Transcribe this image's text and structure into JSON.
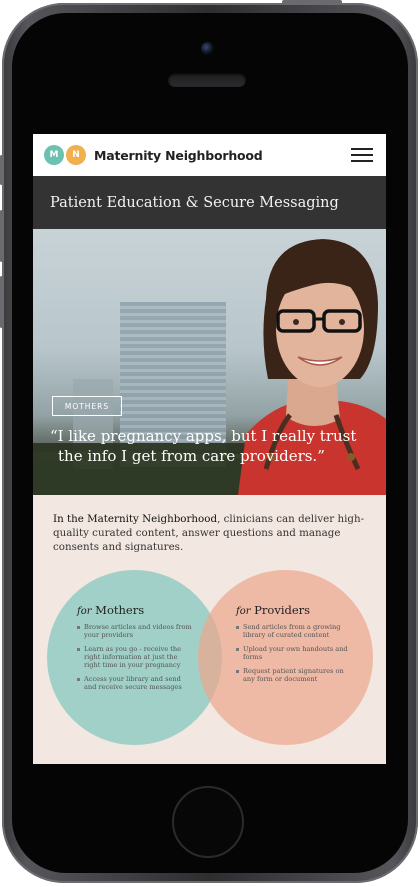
{
  "header": {
    "logo_letters": [
      "M",
      "N"
    ],
    "brand": "Maternity Neighborhood",
    "menu_icon": "hamburger-menu-icon"
  },
  "page": {
    "title": "Patient Education & Secure Messaging"
  },
  "hero": {
    "tag": "MOTHERS",
    "quote_line1": "“I like pregnancy apps, but I really trust",
    "quote_line2": "the info I get from care providers.”"
  },
  "intro": {
    "brand_inline": "In the Maternity Neighborhood",
    "text": ", clinicians can deliver high-quality curated content, answer questions and manage consents and signatures."
  },
  "mothers": {
    "prefix": "for",
    "title": "Mothers",
    "items": [
      "Browse articles and videos from your providers",
      "Learn as you go - receive the right information at just the right time in your pregnancy",
      "Access your library and send and receive secure messages"
    ]
  },
  "providers": {
    "prefix": "for",
    "title": "Providers",
    "items": [
      "Send articles from a growing library of curated content",
      "Upload your own handouts and forms",
      "Request patient signatures on any form or document"
    ]
  },
  "colors": {
    "mothers_circle": "#7fc7bc",
    "providers_circle": "#eca88e",
    "logo_m": "#6cc1b0",
    "logo_n": "#f1b04e",
    "titlebar": "#333333"
  }
}
